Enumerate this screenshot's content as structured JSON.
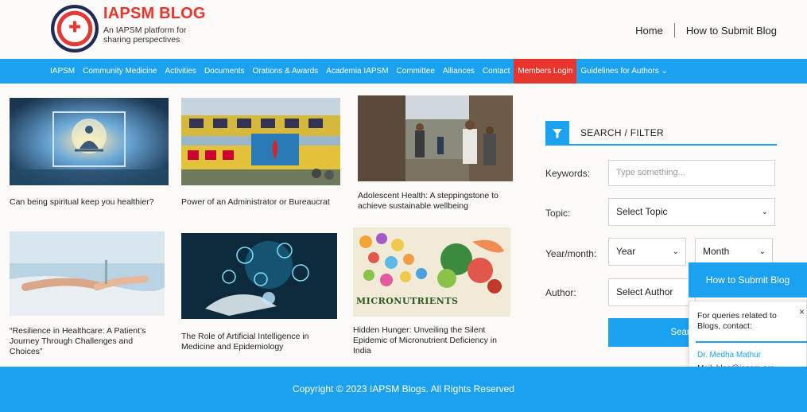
{
  "header": {
    "brand_title": "IAPSM BLOG",
    "brand_subtitle": "An IAPSM platform for sharing perspectives",
    "logo_text": "I.A.P.S.M.",
    "nav_home": "Home",
    "nav_submit": "How to Submit Blog"
  },
  "mainnav": {
    "items": [
      "IAPSM",
      "Community Medicine",
      "Activities",
      "Documents",
      "Orations & Awards",
      "Academia IAPSM",
      "Committee",
      "Alliances",
      "Contact",
      "Members Login",
      "Guidelines for Authors ⌄"
    ]
  },
  "articles": [
    {
      "title": "Can being spiritual keep you healthier?"
    },
    {
      "title": "Power of an Administrator or Bureaucrat"
    },
    {
      "title": "Adolescent Health: A steppingstone to achieve sustainable wellbeing"
    },
    {
      "title": "“Resilience in Healthcare: A Patient’s Journey Through Challenges and Choices”"
    },
    {
      "title": "The Role of Artificial Intelligence in Medicine and Epidemiology"
    },
    {
      "title": "Hidden Hunger: Unveiling the Silent Epidemic of Micronutrient Deficiency in India",
      "image_text": "MICRONUTRIENTS"
    }
  ],
  "filter": {
    "title": "SEARCH / FILTER",
    "keywords_label": "Keywords:",
    "keywords_placeholder": "Type something...",
    "topic_label": "Topic:",
    "topic_value": "Select Topic",
    "yearmonth_label": "Year/month:",
    "year_value": "Year",
    "month_value": "Month",
    "author_label": "Author:",
    "author_value": "Select Author",
    "search_button": "Search / A"
  },
  "popup": {
    "button": "How to Submit Blog",
    "query": "For queries related to Blogs, contact:",
    "name": "Dr. Medha Mathur",
    "mail": "Mail: blog@iapsm.org",
    "close": "×"
  },
  "footer": {
    "copyright": "Copyright © 2023 IAPSM Blogs. All Rights Reserved"
  },
  "colors": {
    "accent": "#1aa1f0",
    "brand_red": "#e8352e"
  }
}
